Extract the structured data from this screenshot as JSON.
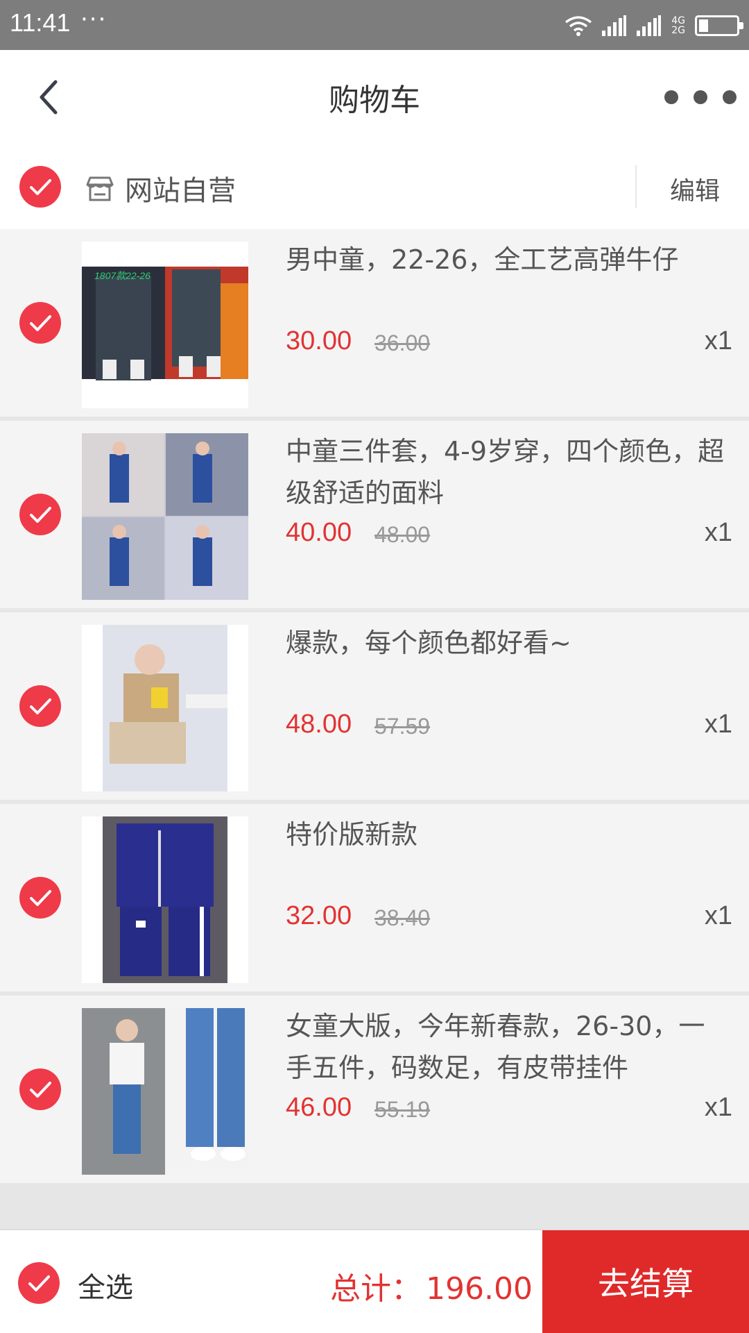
{
  "status_bar": {
    "time": "11:41",
    "dots": "···",
    "network_top": "4G",
    "network_bottom": "2G",
    "battery_level": 0.25
  },
  "nav": {
    "title": "购物车",
    "back_icon": "chevron-left-icon",
    "more_icon": "more-horizontal-icon"
  },
  "shop": {
    "name": "网站自营",
    "edit_label": "编辑",
    "icon": "store-icon"
  },
  "items": [
    {
      "title": "男中童，22-26，全工艺高弹牛仔",
      "price": "30.00",
      "original_price": "36.00",
      "quantity": "x1",
      "image_caption": "1807款22-26"
    },
    {
      "title": "中童三件套，4-9岁穿，四个颜色，超级舒适的面料",
      "price": "40.00",
      "original_price": "48.00",
      "quantity": "x1"
    },
    {
      "title": "爆款，每个颜色都好看~",
      "price": "48.00",
      "original_price": "57.59",
      "quantity": "x1"
    },
    {
      "title": "特价版新款",
      "price": "32.00",
      "original_price": "38.40",
      "quantity": "x1"
    },
    {
      "title": "女童大版，今年新春款，26-30，一手五件，码数足，有皮带挂件",
      "price": "46.00",
      "original_price": "55.19",
      "quantity": "x1"
    }
  ],
  "footer": {
    "select_all_label": "全选",
    "total_label": "总计：",
    "total_value": "196.00",
    "checkout_label": "去结算"
  },
  "colors": {
    "accent_red": "#e02a2a",
    "check_red": "#ef3a49",
    "price_red": "#e33232"
  }
}
